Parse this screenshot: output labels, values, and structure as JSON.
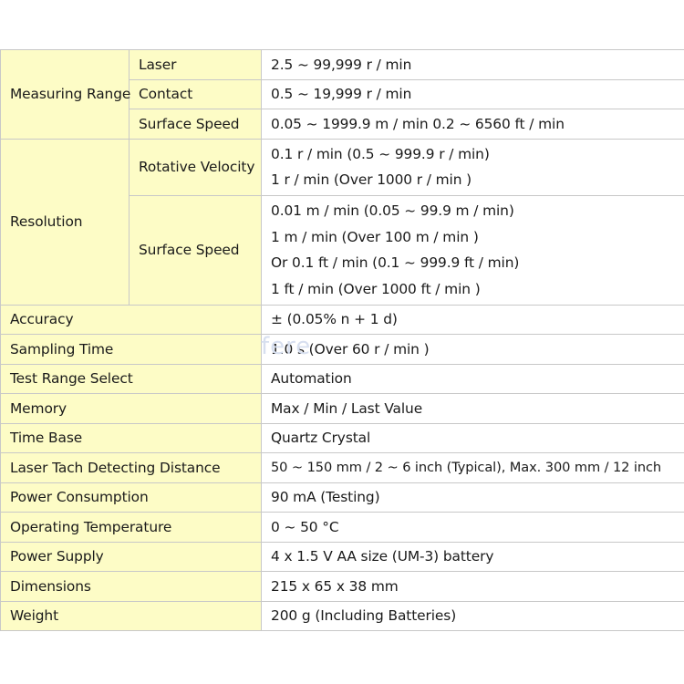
{
  "table": {
    "measuring_range": {
      "label": "Measuring Range",
      "rows": [
        {
          "label": "Laser",
          "value": "2.5 ~ 99,999 r / min"
        },
        {
          "label": "Contact",
          "value": "0.5 ~ 19,999 r / min"
        },
        {
          "label": "Surface Speed",
          "value": "0.05 ~ 1999.9 m / min 0.2 ~ 6560 ft / min"
        }
      ]
    },
    "resolution": {
      "label": "Resolution",
      "rotative": {
        "label": "Rotative Velocity",
        "lines": [
          "0.1 r / min (0.5 ~ 999.9 r / min)",
          "1 r / min (Over 1000 r / min )"
        ]
      },
      "surface": {
        "label": "Surface Speed",
        "lines": [
          "0.01 m / min (0.05 ~ 99.9 m / min)",
          "1 m / min (Over 100 m / min )",
          "Or 0.1 ft / min (0.1 ~ 999.9 ft / min)",
          "1 ft / min (Over 1000 ft / min )"
        ]
      }
    },
    "rows": [
      {
        "label": "Accuracy",
        "value": "± (0.05% n + 1 d)"
      },
      {
        "label": "Sampling Time",
        "value": "1.0 s (Over 60 r / min )"
      },
      {
        "label": "Test Range Select",
        "value": "Automation"
      },
      {
        "label": "Memory",
        "value": "Max / Min / Last Value"
      },
      {
        "label": "Time Base",
        "value": "Quartz Crystal"
      },
      {
        "label": "Laser Tach Detecting Distance",
        "value": "50 ~ 150 mm / 2 ~ 6 inch (Typical), Max. 300 mm / 12 inch"
      },
      {
        "label": "Power Consumption",
        "value": "90 mA (Testing)"
      },
      {
        "label": "Operating Temperature",
        "value": "0 ~ 50 °C"
      },
      {
        "label": "Power Supply",
        "value": "4 x 1.5 V AA size (UM-3) battery"
      },
      {
        "label": "Dimensions",
        "value": "215 x 65 x 38 mm"
      },
      {
        "label": "Weight",
        "value": "200 g (Including Batteries)"
      }
    ]
  },
  "watermark": "fere"
}
